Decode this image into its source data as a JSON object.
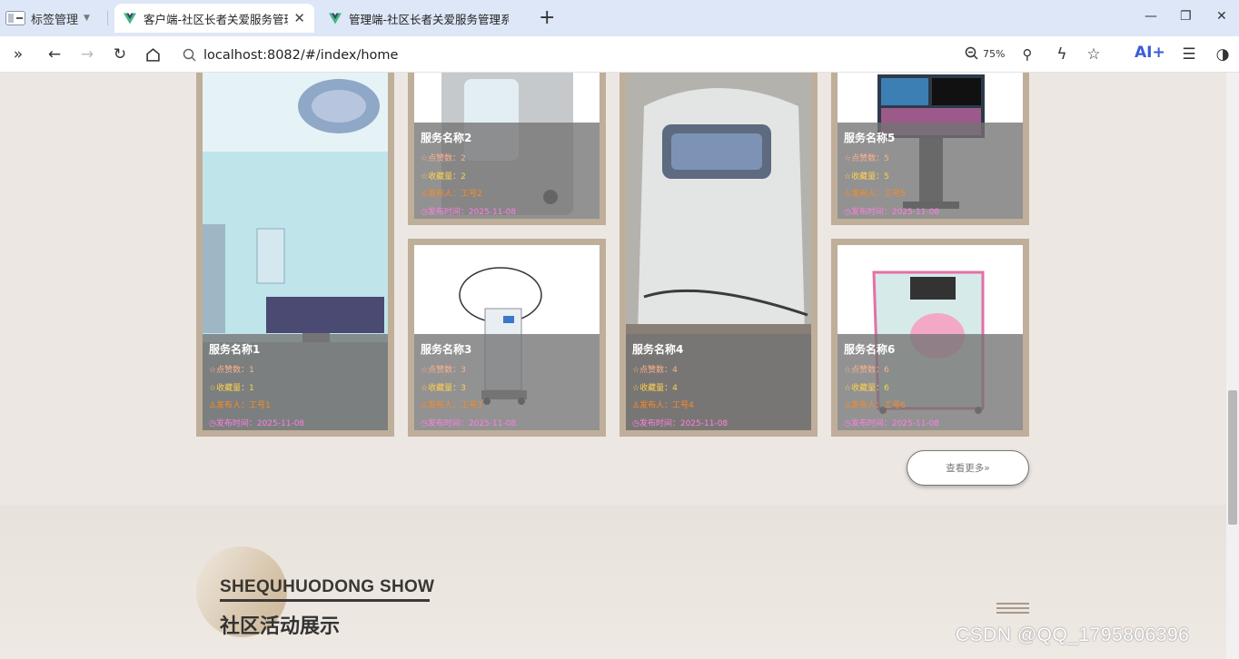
{
  "browser": {
    "tab_manager_label": "标签管理",
    "tabs": [
      {
        "title": "客户端-社区长者关爱服务管理",
        "close": "✕"
      },
      {
        "title": "管理端-社区长者关爱服务管理系"
      }
    ],
    "new_tab": "+",
    "url": "localhost:8082/#/index/home",
    "zoom": "75%",
    "ai_label": "AI+"
  },
  "cards": [
    {
      "name": "服务名称1",
      "like": "☆点赞数：1",
      "fav": "☆收藏量：1",
      "publisher": "♙发布人：工号1",
      "time": "◷发布时间：2025-11-08"
    },
    {
      "name": "服务名称2",
      "like": "☆点赞数：2",
      "fav": "☆收藏量：2",
      "publisher": "♙发布人：工号2",
      "time": "◷发布时间：2025-11-08"
    },
    {
      "name": "服务名称3",
      "like": "☆点赞数：3",
      "fav": "☆收藏量：3",
      "publisher": "♙发布人：工号3",
      "time": "◷发布时间：2025-11-08"
    },
    {
      "name": "服务名称4",
      "like": "☆点赞数：4",
      "fav": "☆收藏量：4",
      "publisher": "♙发布人：工号4",
      "time": "◷发布时间：2025-11-08"
    },
    {
      "name": "服务名称5",
      "like": "☆点赞数：5",
      "fav": "☆收藏量：5",
      "publisher": "♙发布人：工号5",
      "time": "◷发布时间：2025-11-08"
    },
    {
      "name": "服务名称6",
      "like": "☆点赞数：6",
      "fav": "☆收藏量：6",
      "publisher": "♙发布人：工号6",
      "time": "◷发布时间：2025-11-08"
    }
  ],
  "more_button": "查看更多»",
  "section": {
    "title_en": "SHEQUHUODONG SHOW",
    "title_cn": "社区活动展示"
  },
  "watermark": "CSDN @QQ_1795806396",
  "colors": {
    "card_frame": "#bfae99",
    "like": "#ffb08a",
    "fav": "#ffd04d",
    "publisher": "#ff8a1e",
    "time": "#ff7fe0"
  }
}
